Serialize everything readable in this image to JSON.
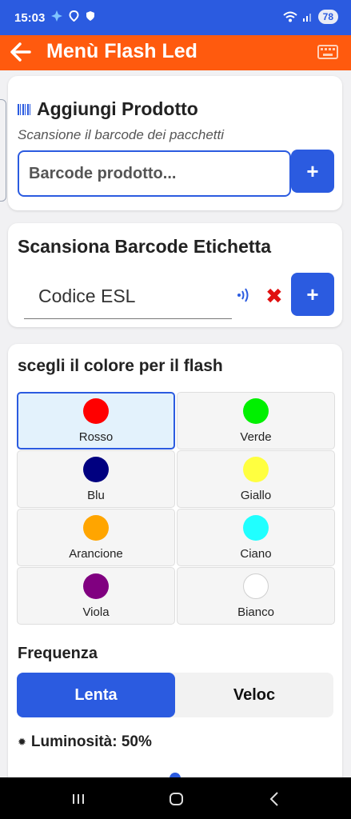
{
  "status": {
    "time": "15:03",
    "battery": "78"
  },
  "appbar": {
    "title": "Menù Flash Led"
  },
  "add_product": {
    "title": "Aggiungi Prodotto",
    "subtitle": "Scansione il barcode dei pacchetti",
    "input_placeholder": "Barcode prodotto...",
    "add_label": "+"
  },
  "scan_label": {
    "title": "Scansiona Barcode Etichetta",
    "esl_value": "Codice ESL",
    "clear_label": "✖",
    "add_label": "+"
  },
  "flash_color": {
    "title": "scegli il colore per il flash",
    "selected": "Rosso",
    "colors": [
      {
        "name": "Rosso",
        "hex": "#ff0000"
      },
      {
        "name": "Verde",
        "hex": "#00f000"
      },
      {
        "name": "Blu",
        "hex": "#000080"
      },
      {
        "name": "Giallo",
        "hex": "#ffff40"
      },
      {
        "name": "Arancione",
        "hex": "#ffa500"
      },
      {
        "name": "Ciano",
        "hex": "#20ffff"
      },
      {
        "name": "Viola",
        "hex": "#800080"
      },
      {
        "name": "Bianco",
        "hex": "#ffffff"
      }
    ]
  },
  "frequency": {
    "label": "Frequenza",
    "options": [
      "Lenta",
      "Veloc"
    ],
    "selected": "Lenta"
  },
  "brightness": {
    "icon": "sun-icon",
    "label": "Luminosità: 50%",
    "value_percent": 50
  },
  "colors": {
    "primary": "#2b5be0",
    "appbar": "#ff5a0e",
    "danger": "#e01010"
  }
}
